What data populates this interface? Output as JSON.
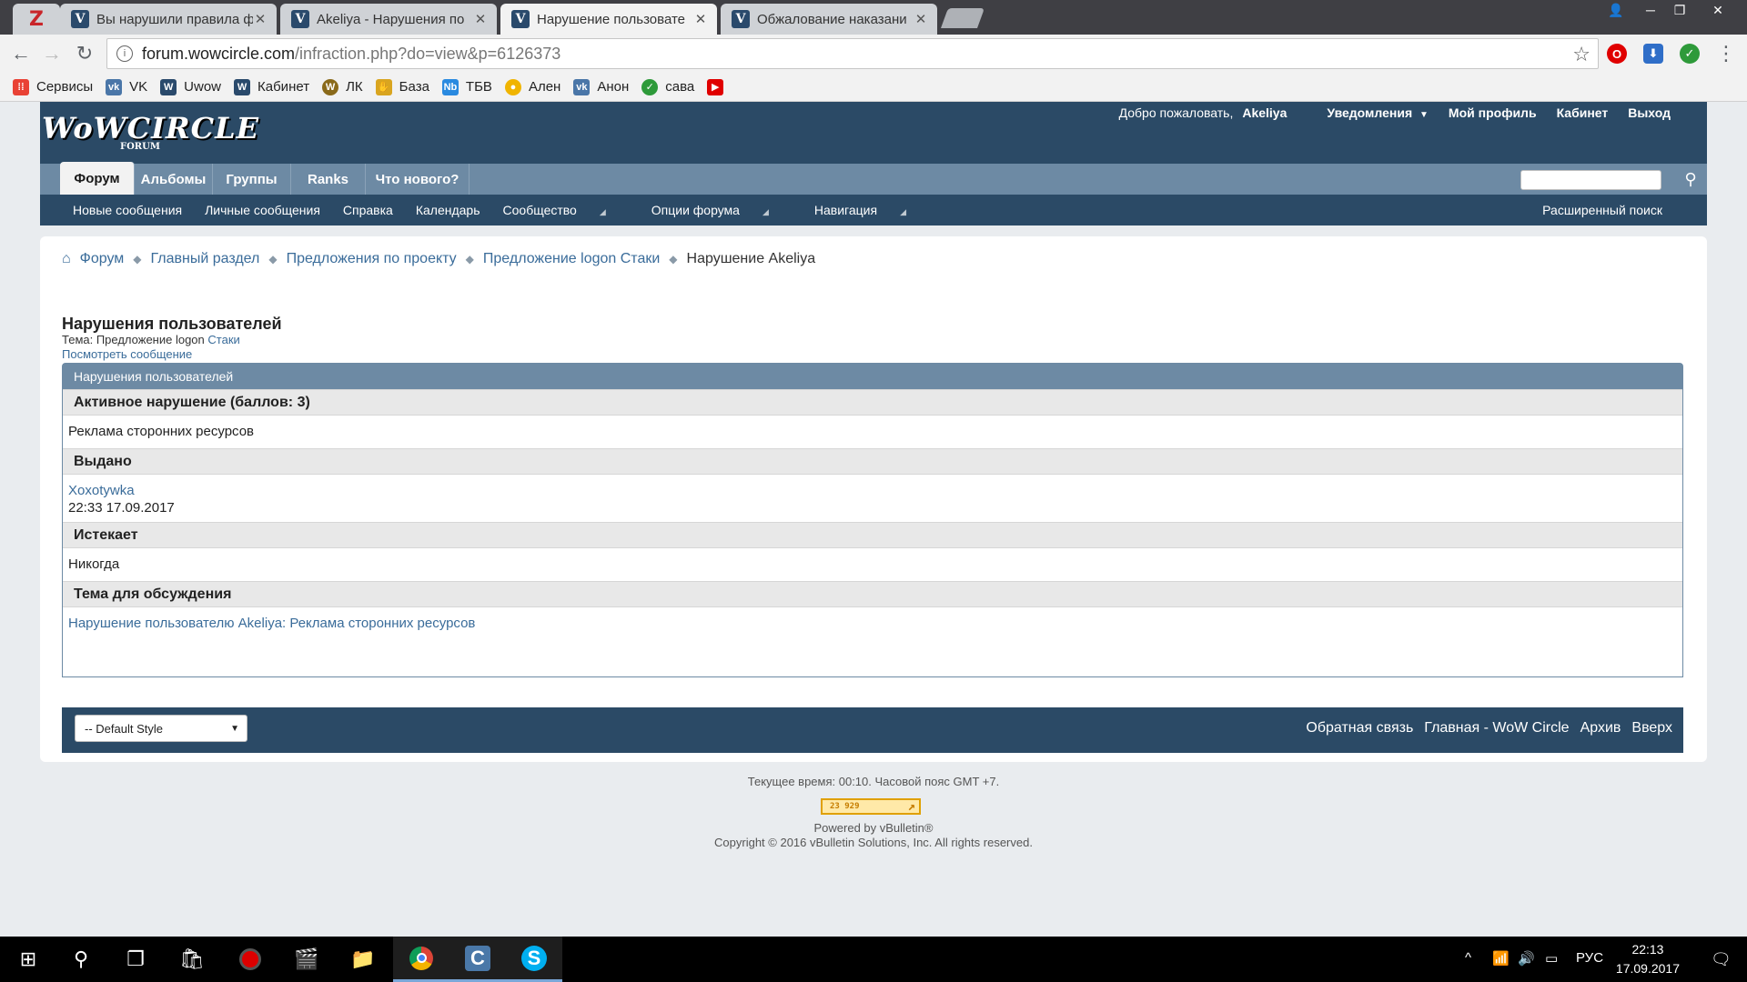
{
  "browser": {
    "tabs": [
      {
        "title": "Вы нарушили правила ф",
        "active": false
      },
      {
        "title": "Akeliya - Нарушения по",
        "active": false
      },
      {
        "title": "Нарушение пользовате",
        "active": true
      },
      {
        "title": "Обжалование наказани",
        "active": false
      }
    ],
    "address": {
      "host": "forum.wowcircle.com",
      "path": "/infraction.php?do=view&p=6126373"
    },
    "bookmarks": [
      {
        "label": "Сервисы",
        "icon": "apps-grid-icon",
        "color": "#e94235"
      },
      {
        "label": "VK",
        "icon": "vk-icon",
        "color": "#4a76a8"
      },
      {
        "label": "Uwow",
        "icon": "w-icon",
        "color": "#2a4a6c"
      },
      {
        "label": "Кабинет",
        "icon": "w-icon",
        "color": "#2a4a6c"
      },
      {
        "label": "ЛК",
        "icon": "wow-icon",
        "color": "#8a6a1a"
      },
      {
        "label": "База",
        "icon": "hand-icon",
        "color": "#d9a520"
      },
      {
        "label": "ТБВ",
        "icon": "nb-icon",
        "color": "#2a8ae0"
      },
      {
        "label": "Ален",
        "icon": "circle-icon",
        "color": "#f0b400"
      },
      {
        "label": "Анон",
        "icon": "vk-icon",
        "color": "#4a76a8"
      },
      {
        "label": "сава",
        "icon": "shield-icon",
        "color": "#2e9a3a"
      },
      {
        "label": "",
        "icon": "youtube-icon",
        "color": "#e00000"
      }
    ]
  },
  "header": {
    "logo": "WoWCIRCLE",
    "logo_sub": "FORUM",
    "welcome": "Добро пожаловать,",
    "user": "Akeliya",
    "notifications": "Уведомления",
    "profile": "Мой профиль",
    "cabinet": "Кабинет",
    "logout": "Выход",
    "tabs": [
      "Форум",
      "Альбомы",
      "Группы",
      "Ranks",
      "Что нового?"
    ],
    "subnav": [
      "Новые сообщения",
      "Личные сообщения",
      "Справка",
      "Календарь",
      "Сообщество",
      "Опции форума",
      "Навигация"
    ],
    "advanced_search": "Расширенный поиск"
  },
  "breadcrumb": [
    "Форум",
    "Главный раздел",
    "Предложения по проекту",
    "Предложение logon Стаки",
    "Нарушение Akeliya"
  ],
  "page": {
    "title": "Нарушения пользователей",
    "topic_label": "Тема: Предложение logon",
    "topic_link": "Стаки",
    "view_post": "Посмотреть сообщение",
    "block_title": "Нарушения пользователей",
    "sections": [
      {
        "head": "Активное нарушение (баллов: 3)",
        "lines": [
          "Реклама сторонних ресурсов"
        ],
        "link": ""
      },
      {
        "head": "Выдано",
        "link": "Xoxotywka",
        "lines": [
          "22:33 17.09.2017"
        ]
      },
      {
        "head": "Истекает",
        "lines": [
          "Никогда"
        ],
        "link": ""
      },
      {
        "head": "Тема для обсуждения",
        "link": "Нарушение пользователю Akeliya: Реклама сторонних ресурсов",
        "lines": []
      }
    ]
  },
  "footer": {
    "style_select": "-- Default Style",
    "links": [
      "Обратная связь",
      "Главная - WoW Circle",
      "Архив",
      "Вверх"
    ],
    "time": "Текущее время: 00:10. Часовой пояс GMT +7.",
    "counter": "23 929",
    "powered": "Powered by vBulletin®",
    "copyright": "Copyright © 2016 vBulletin Solutions, Inc. All rights reserved."
  },
  "taskbar": {
    "lang": "РУС",
    "time": "22:13",
    "date": "17.09.2017"
  }
}
